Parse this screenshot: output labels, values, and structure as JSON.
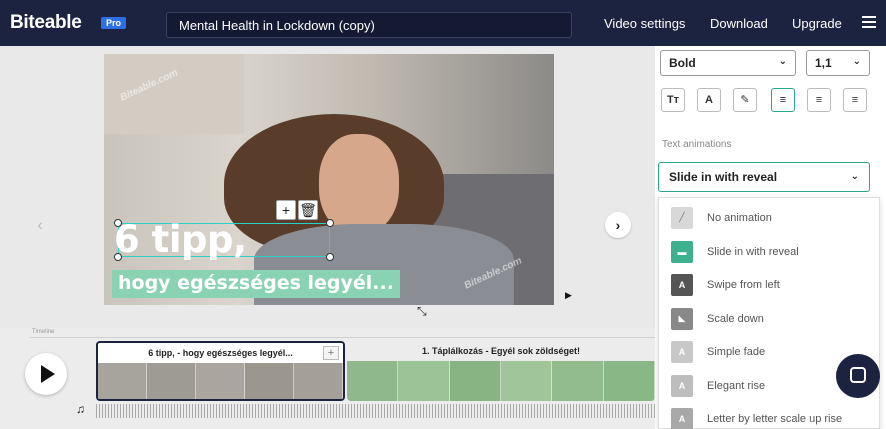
{
  "header": {
    "logo": "Biteable",
    "badge": "Pro",
    "project_title": "Mental Health in Lockdown (copy)",
    "nav": [
      "Video settings",
      "Download",
      "Upgrade"
    ]
  },
  "canvas": {
    "watermark": "Biteable.com",
    "caption_line1": "6 tipp,",
    "caption_line2": "hogy egészséges legyél...",
    "add_icon": "plus-icon",
    "delete_icon": "trash-icon"
  },
  "panel": {
    "font_weight": "Bold",
    "line_spacing": "1,1",
    "format_buttons": [
      "Tт",
      "A",
      "✎",
      "≡",
      "≡",
      "≡"
    ],
    "animations_label": "Text animations",
    "selected_animation": "Slide in with reveal",
    "animation_options": [
      {
        "label": "No animation",
        "icon": "slash-icon"
      },
      {
        "label": "Slide in with reveal",
        "icon": "slide-reveal-icon",
        "active": true
      },
      {
        "label": "Swipe from left",
        "icon": "swipe-left-icon"
      },
      {
        "label": "Scale down",
        "icon": "scale-down-icon"
      },
      {
        "label": "Simple fade",
        "icon": "fade-icon"
      },
      {
        "label": "Elegant rise",
        "icon": "rise-icon"
      },
      {
        "label": "Letter by letter scale up rise",
        "icon": "letter-scale-icon"
      }
    ]
  },
  "timeline": {
    "ruler_label": "Timeline",
    "clips": [
      {
        "title": "6 tipp, - hogy egészséges legyél...",
        "active": true
      },
      {
        "title": "1. Táplálkozás - Egyél sok zöldséget!",
        "active": false
      }
    ],
    "add_label": "+"
  },
  "colors": {
    "topbar": "#1c2340",
    "accent": "#2aa58c",
    "caption_bg": "#89d3b3",
    "pro_badge": "#2f6fe4"
  }
}
